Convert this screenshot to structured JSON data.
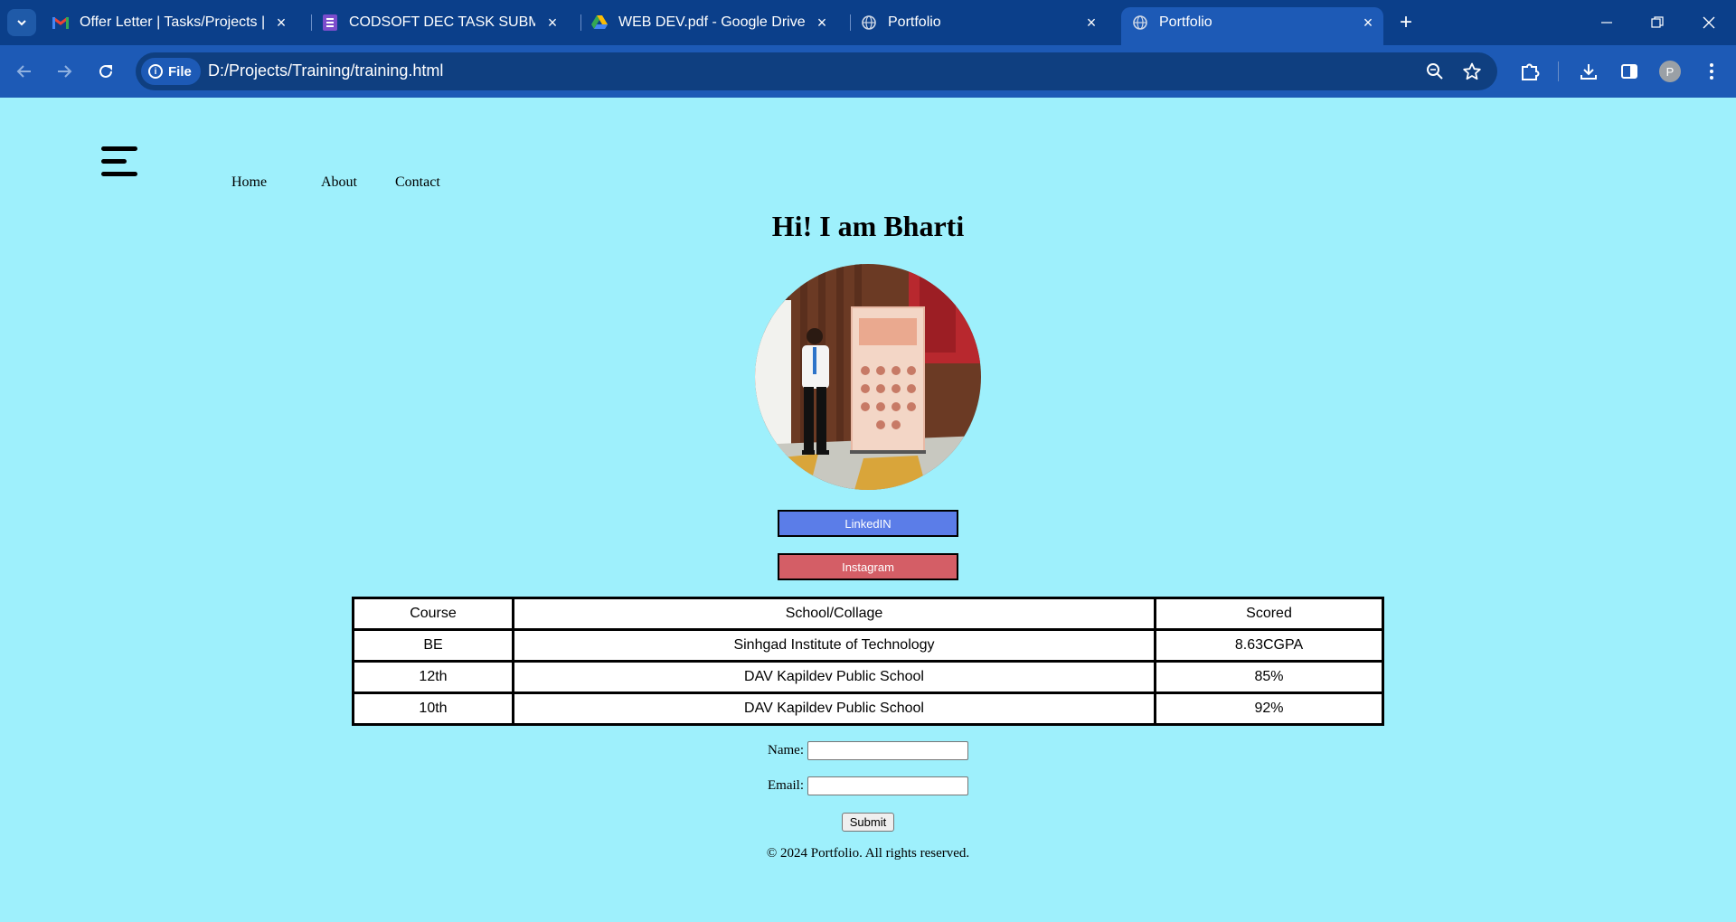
{
  "browser": {
    "tabs": [
      {
        "title": "Offer Letter | Tasks/Projects | Co",
        "icon": "gmail-icon",
        "active": false
      },
      {
        "title": "CODSOFT DEC TASK SUBMISSI",
        "icon": "forms-icon",
        "active": false
      },
      {
        "title": "WEB DEV.pdf - Google Drive",
        "icon": "drive-icon",
        "active": false
      },
      {
        "title": "Portfolio",
        "icon": "globe-icon",
        "active": false
      },
      {
        "title": "Portfolio",
        "icon": "globe-icon",
        "active": true
      }
    ],
    "address": {
      "chip_label": "File",
      "url": "D:/Projects/Training/training.html"
    },
    "profile_initial": "P"
  },
  "page": {
    "nav": [
      "Home",
      "About",
      "Contact"
    ],
    "heading": "Hi! I am Bharti",
    "buttons": {
      "linkedin": "LinkedIN",
      "instagram": "Instagram"
    },
    "table": {
      "headers": [
        "Course",
        "School/Collage",
        "Scored"
      ],
      "rows": [
        [
          "BE",
          "Sinhgad Institute of Technology",
          "8.63CGPA"
        ],
        [
          "12th",
          "DAV Kapildev Public School",
          "85%"
        ],
        [
          "10th",
          "DAV Kapildev Public School",
          "92%"
        ]
      ]
    },
    "form": {
      "name_label": "Name:",
      "email_label": "Email:",
      "name_value": "",
      "email_value": "",
      "submit": "Submit"
    },
    "footer": "© 2024 Portfolio. All rights reserved."
  },
  "colors": {
    "page_bg": "#9ef0fc",
    "linkedin": "#5b7de8",
    "instagram": "#d45e66",
    "browser_frame": "#0b3f8a",
    "toolbar": "#1d5ab6"
  }
}
